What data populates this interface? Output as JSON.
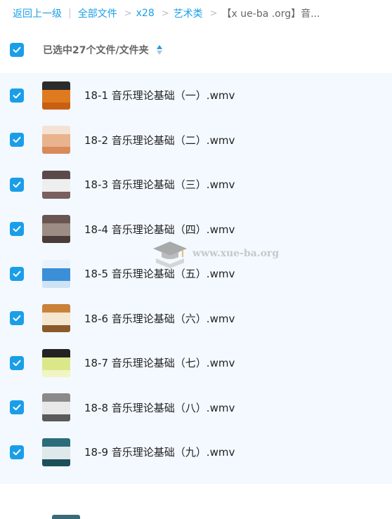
{
  "breadcrumb": {
    "back": "返回上一级",
    "root": "全部文件",
    "level1": "x28",
    "level2": "艺术类",
    "current": "【x ue-ba .org】音..."
  },
  "selection": {
    "label": "已选中27个文件/文件夹"
  },
  "files": [
    {
      "name": "18-1 音乐理论基础（一）.wmv",
      "thumb_colors": [
        "#2b2b2b",
        "#e07a1f",
        "#c85f12"
      ]
    },
    {
      "name": "18-2 音乐理论基础（二）.wmv",
      "thumb_colors": [
        "#f4e3d4",
        "#e9b48d",
        "#d98a5a"
      ]
    },
    {
      "name": "18-3 音乐理论基础（三）.wmv",
      "thumb_colors": [
        "#5a4a4a",
        "#eeeeee",
        "#7a6060"
      ]
    },
    {
      "name": "18-4 音乐理论基础（四）.wmv",
      "thumb_colors": [
        "#6a5650",
        "#9c8c84",
        "#4a3c38"
      ]
    },
    {
      "name": "18-5 音乐理论基础（五）.wmv",
      "thumb_colors": [
        "#eaf2fb",
        "#3a8fd6",
        "#cfe3f6"
      ]
    },
    {
      "name": "18-6 音乐理论基础（六）.wmv",
      "thumb_colors": [
        "#c9823a",
        "#f5e6d0",
        "#8a5a2a"
      ]
    },
    {
      "name": "18-7 音乐理论基础（七）.wmv",
      "thumb_colors": [
        "#222222",
        "#dbe88a",
        "#f0f5c2"
      ]
    },
    {
      "name": "18-8 音乐理论基础（八）.wmv",
      "thumb_colors": [
        "#8a8a8a",
        "#e8e8e8",
        "#5a5a5a"
      ]
    },
    {
      "name": "18-9 音乐理论基础（九）.wmv",
      "thumb_colors": [
        "#2a6c7a",
        "#dfe9ec",
        "#1d4f5a"
      ]
    },
    {
      "name": "",
      "thumb_colors": [
        "#3a6a78",
        "#3a6a78",
        "#3a6a78"
      ]
    }
  ],
  "watermark": {
    "text": "www.xue-ba.org"
  },
  "colors": {
    "accent": "#1a9ee8",
    "list_bg": "#f3f9ff"
  }
}
